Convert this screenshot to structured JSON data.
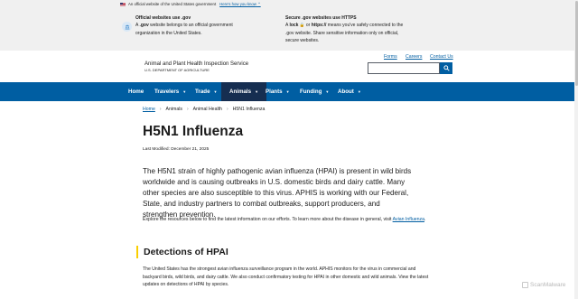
{
  "gov_banner": {
    "official_text": "An official website of the United States government",
    "how_link": "Here's how you know",
    "col1_title": "Official websites use .gov",
    "col1_body_a": "A ",
    "col1_body_bold": ".gov",
    "col1_body_b": " website belongs to an official government organization in the United States.",
    "col2_title": "Secure .gov websites use HTTPS",
    "col2_body_a": "A ",
    "col2_body_lock_bold": "lock",
    "col2_body_or": " or ",
    "col2_body_https_bold": "https://",
    "col2_body_b": " means you've safely connected to the .gov website. Share sensitive information only on official, secure websites."
  },
  "header": {
    "agency_name": "Animal and Plant Health Inspection Service",
    "department": "U.S. DEPARTMENT OF AGRICULTURE",
    "utility_links": [
      "Forms",
      "Careers",
      "Contact Us"
    ]
  },
  "nav": {
    "home": "Home",
    "items": [
      "Travelers",
      "Trade",
      "Animals",
      "Plants",
      "Funding",
      "About"
    ],
    "active": "Animals"
  },
  "breadcrumb": [
    "Home",
    "Animals",
    "Animal Health",
    "H5N1 Influenza"
  ],
  "page": {
    "title": "H5N1 Influenza",
    "last_modified": "Last Modified: December 21, 2025",
    "lead": "The H5N1 strain of highly pathogenic avian influenza (HPAI) is present in wild birds worldwide and is causing outbreaks in U.S. domestic birds and dairy cattle. Many other species are also susceptible to this virus. APHIS is working with our Federal, State, and industry partners to combat outbreaks, support producers, and strengthen prevention.",
    "explore_text": "Explore the resources below to find the latest information on our efforts. To learn more about the disease in general, visit ",
    "explore_link": "Avian Influenza",
    "explore_end": ".",
    "section_title": "Detections of HPAI",
    "section_body": "The United States has the strongest avian influenza surveillance program in the world. APHIS monitors for the virus in commercial and backyard birds, wild birds, and dairy cattle. We also conduct confirmatory testing for HPAI in other domestic and wild animals. View the latest updates on detections of HPAI by species."
  },
  "watermark": "ScanMalware",
  "colors": {
    "nav": "#005ea2",
    "nav_active": "#162e51",
    "accent": "#face00",
    "link": "#005ea2"
  }
}
